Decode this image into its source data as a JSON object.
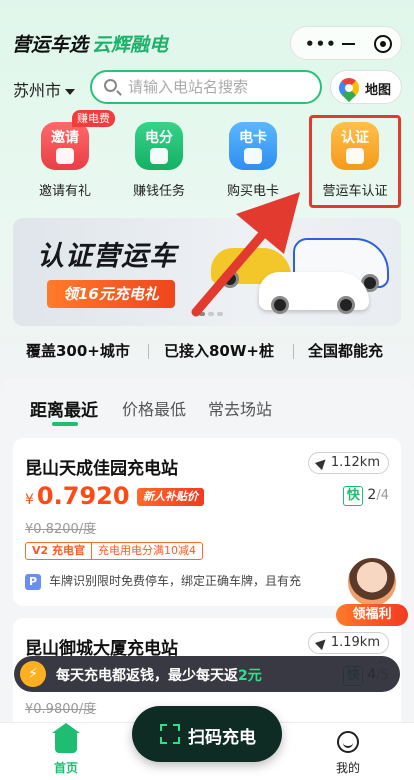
{
  "header": {
    "brand_primary": "营运车选",
    "brand_secondary": "云辉融电",
    "more_glyph": "•••"
  },
  "search": {
    "city": "苏州市",
    "placeholder": "请输入电站名搜索",
    "map_label": "地图"
  },
  "quick": [
    {
      "title": "邀请",
      "label": "邀请有礼",
      "badge": "赚电费",
      "color": "#f0494f",
      "icon": "gift-icon"
    },
    {
      "title": "电分",
      "label": "赚钱任务",
      "color": "#1bbd6e",
      "icon": "lightning-icon"
    },
    {
      "title": "电卡",
      "label": "购买电卡",
      "color": "#3a9ff2",
      "icon": "card-icon"
    },
    {
      "title": "认证",
      "label": "营运车认证",
      "color": "#f7a92c",
      "icon": "shield-check-icon"
    }
  ],
  "banner": {
    "title": "认证营运车",
    "subtitle": "领16元充电礼"
  },
  "stats": [
    "覆盖300+城市",
    "已接入80W+桩",
    "全国都能充"
  ],
  "tabs": [
    "距离最近",
    "价格最低",
    "常去场站"
  ],
  "stations": [
    {
      "name": "昆山天成佳园充电站",
      "distance": "1.12km",
      "currency": "¥",
      "price": "0.7920",
      "new_tag": "新人补贴价",
      "fast_label": "快",
      "fast_available": "2",
      "fast_total": "/4",
      "old_price": "¥0.8200/度",
      "promo_left": "V2 充电官",
      "promo_right": "充电用电分满10减4",
      "parking_icon": "P",
      "parking_text": "车牌识别限时免费停车，绑定正确车牌，且有充"
    },
    {
      "name": "昆山御城大厦充电站",
      "distance": "1.19km",
      "fast_label": "快",
      "fast_available": "4",
      "fast_total": "/5",
      "old_price": "¥0.9800/度"
    }
  ],
  "reward": {
    "label": "领福利"
  },
  "toast": {
    "text": "每天充电都返钱，最少每天返",
    "highlight": "2元"
  },
  "tabbar": {
    "home": "首页",
    "scan": "扫码充电",
    "mine": "我的"
  },
  "colors": {
    "accent": "#1fbd72",
    "price": "#ff4a16",
    "annotation": "#e23a2e"
  }
}
